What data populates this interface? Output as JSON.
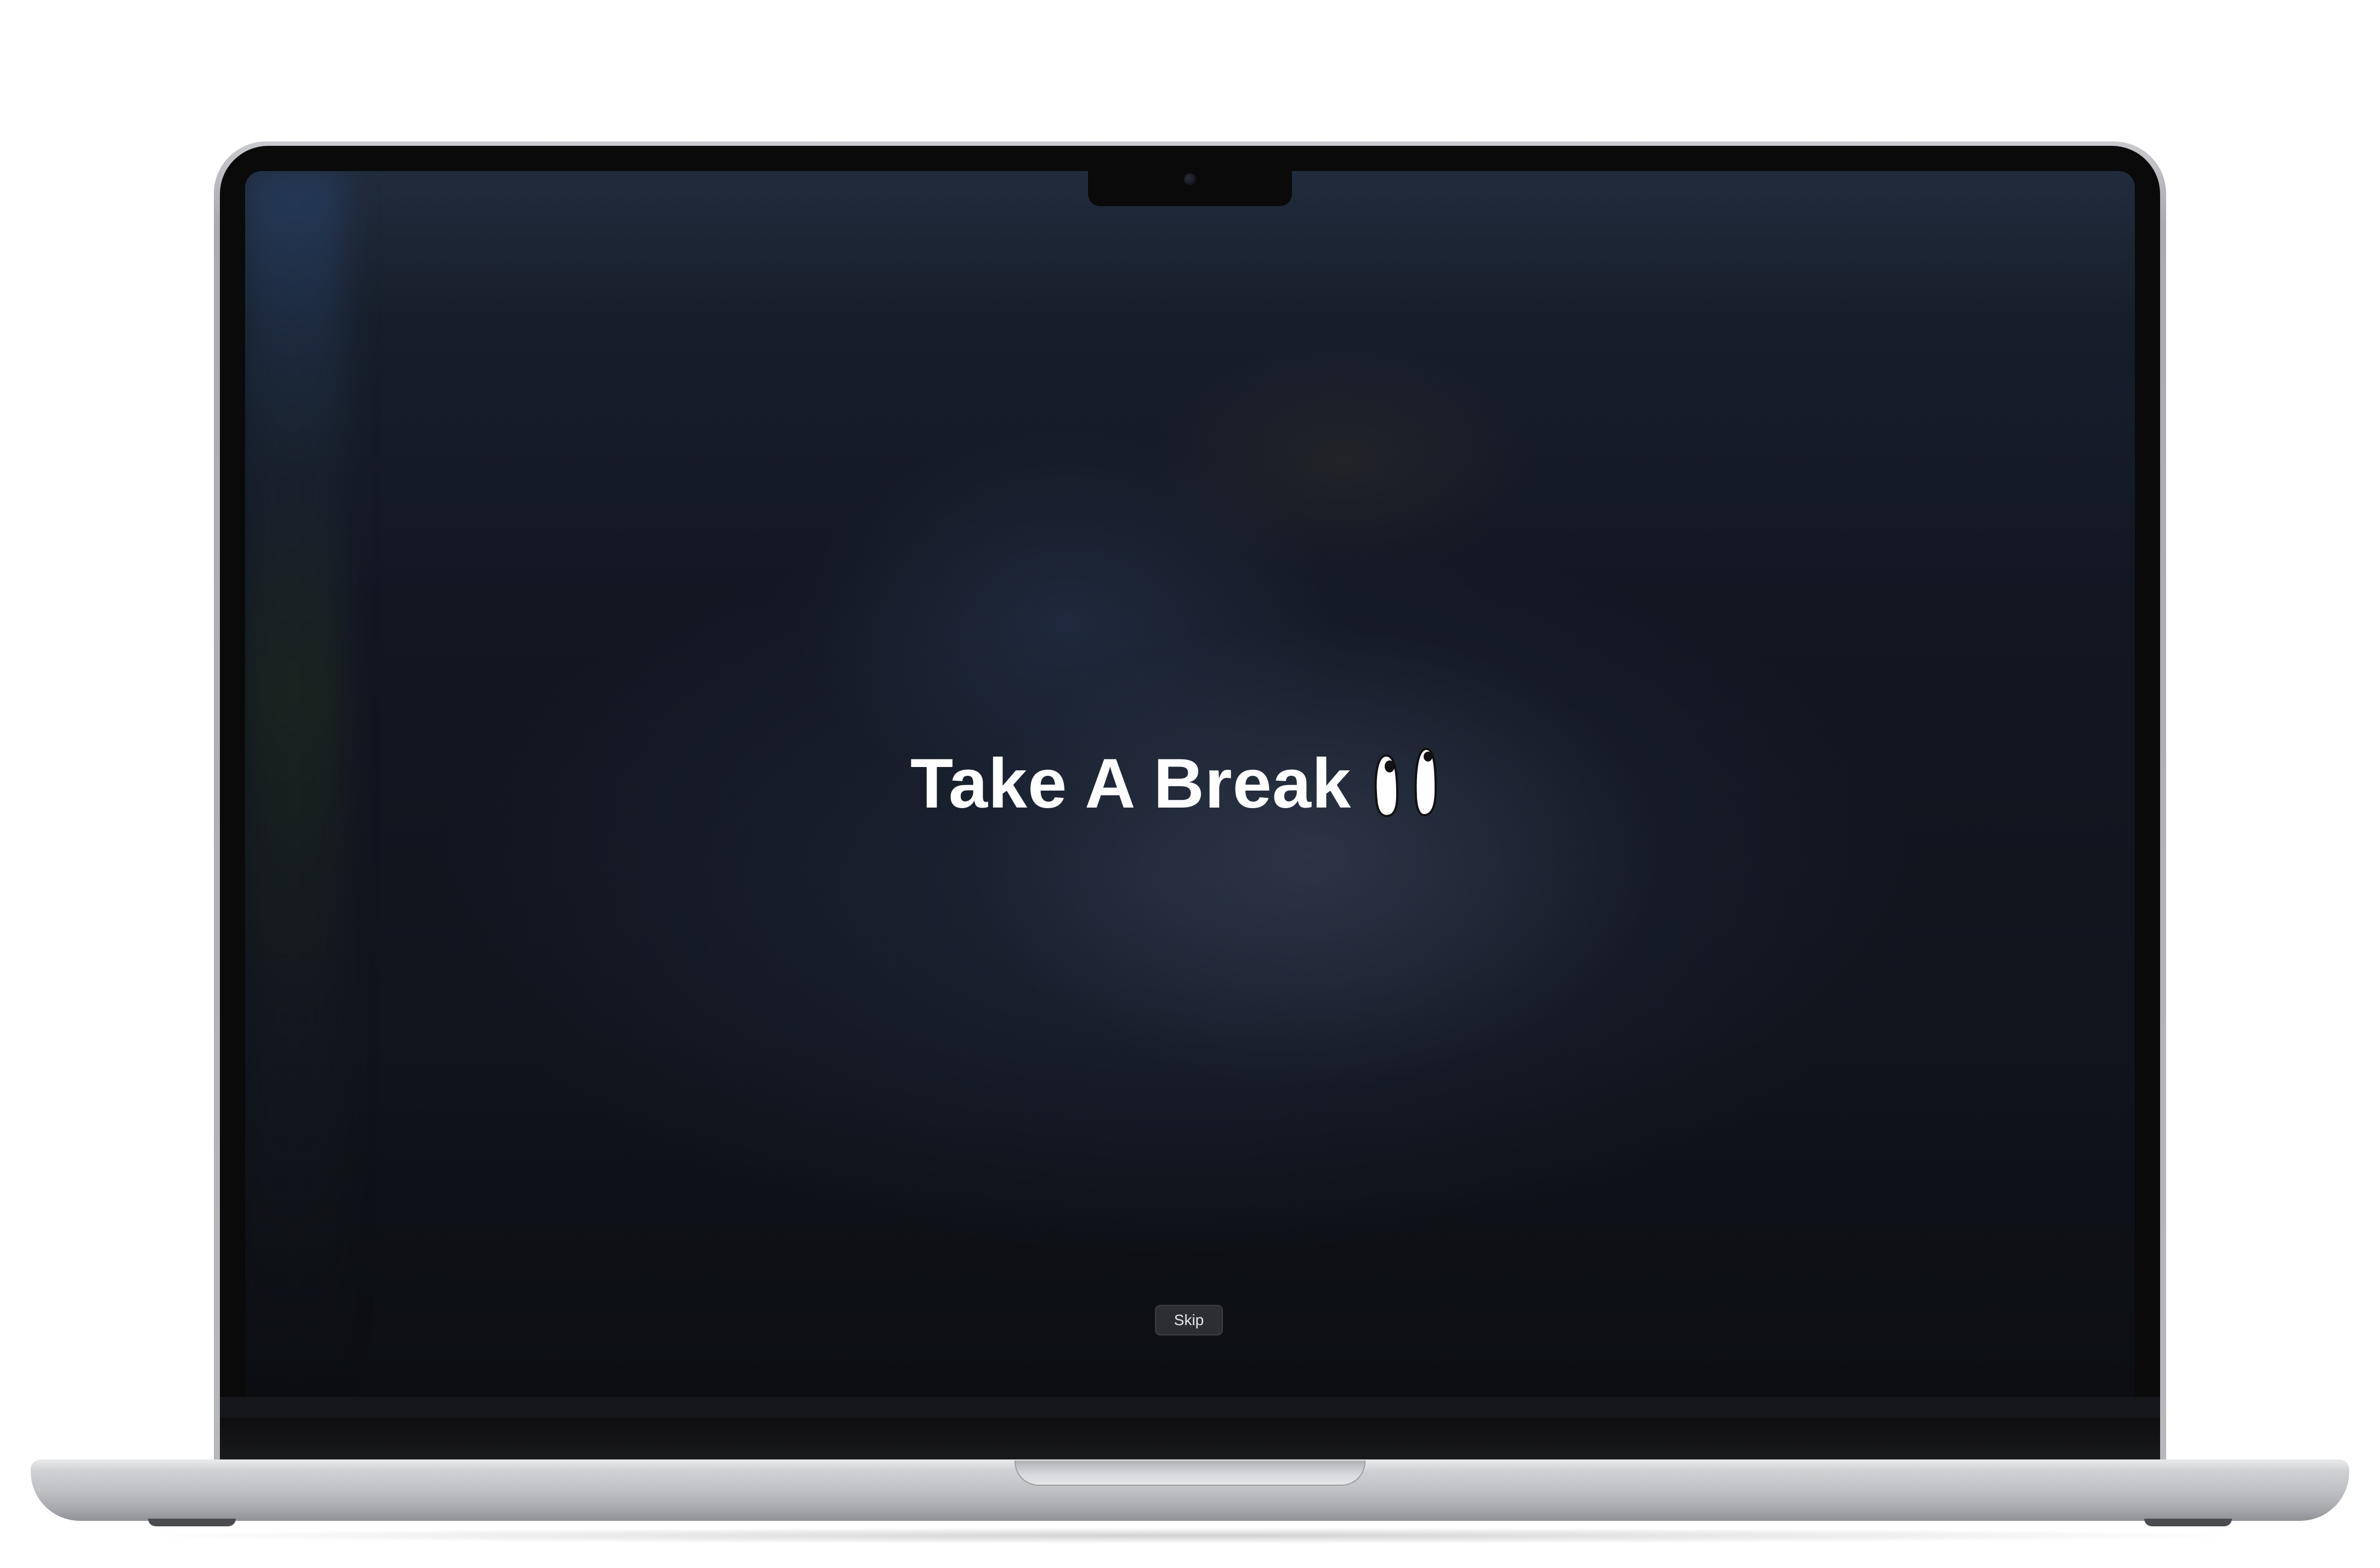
{
  "device": {
    "type": "laptop-mockup",
    "screen_background": "#10141c"
  },
  "break_screen": {
    "title": "Take A Break",
    "title_color": "#ffffff",
    "icon": "eyes-icon"
  },
  "actions": {
    "skip_label": "Skip"
  }
}
